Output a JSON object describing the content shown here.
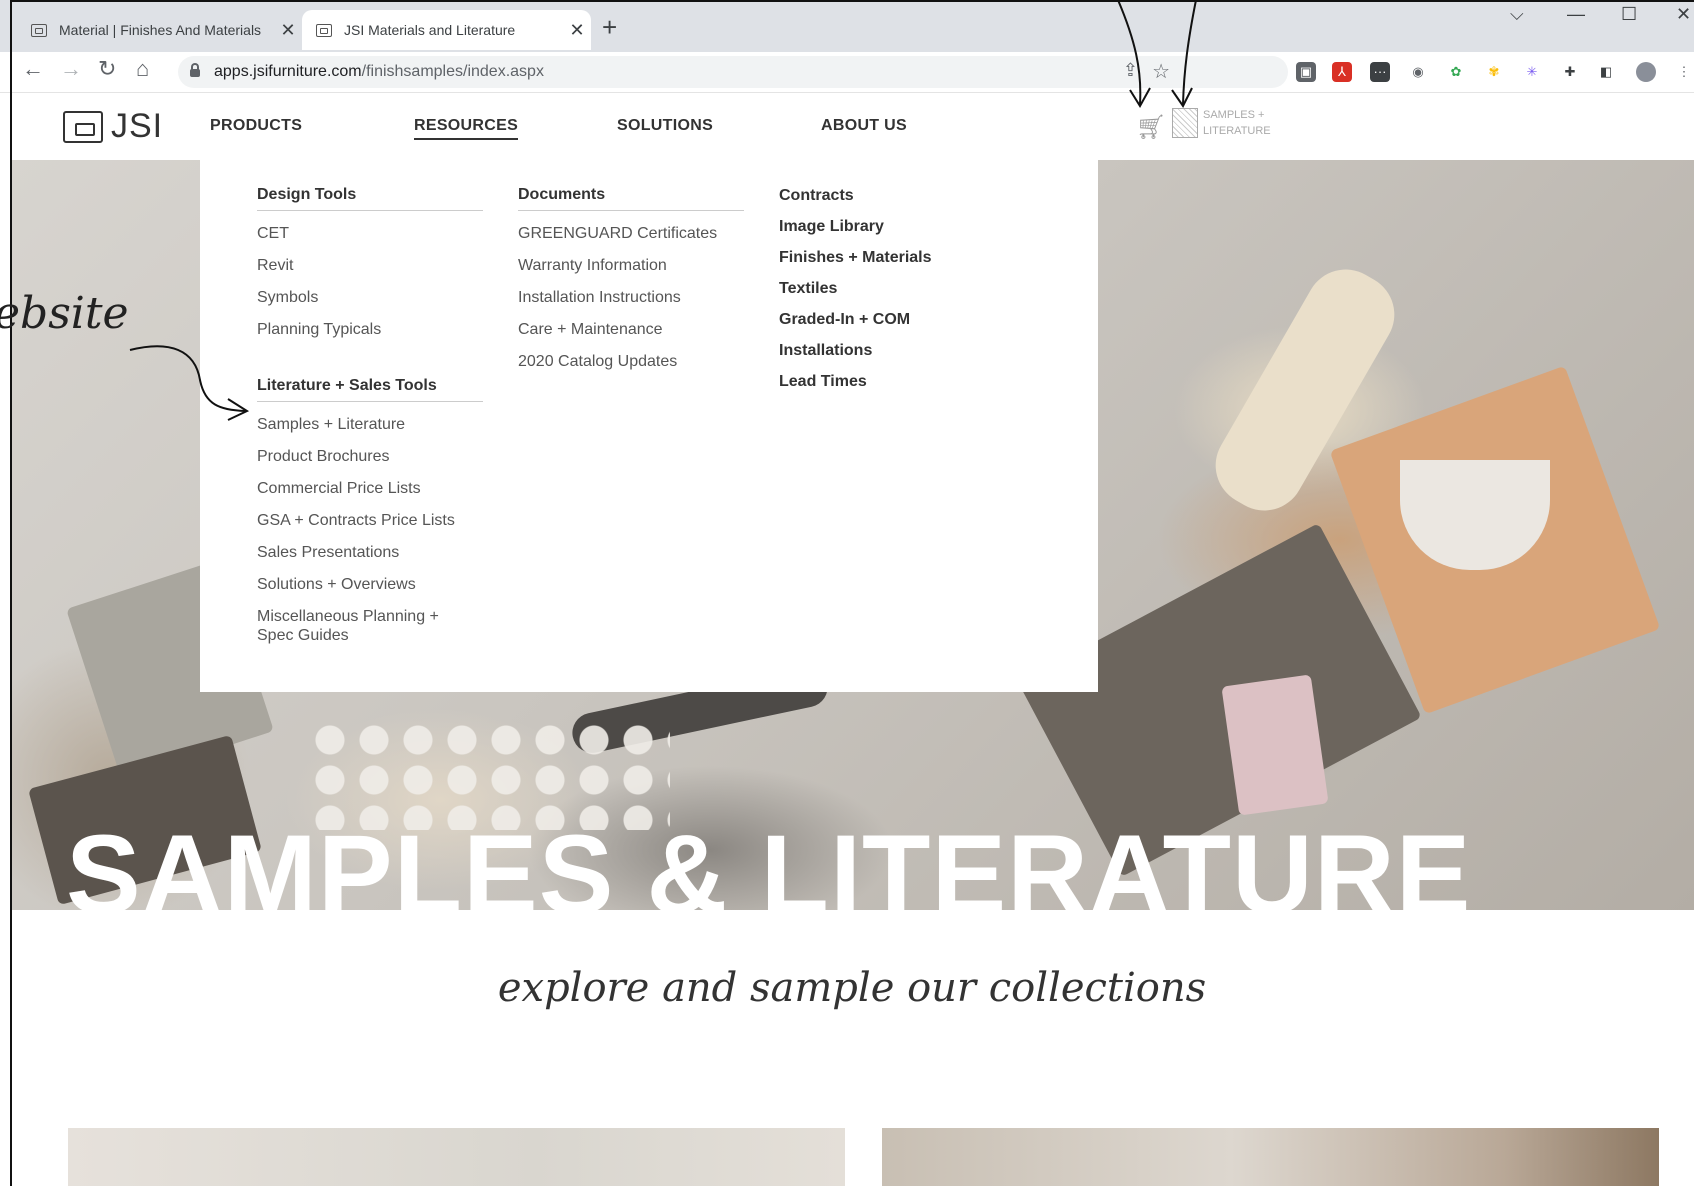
{
  "browser": {
    "tabs": [
      {
        "title": "Material | Finishes And Materials",
        "active": false
      },
      {
        "title": "JSI Materials and Literature",
        "active": true
      }
    ],
    "url_host": "apps.jsifurniture.com",
    "url_path": "/finishsamples/index.aspx",
    "icons": [
      "back-icon",
      "forward-icon",
      "reload-icon",
      "home-icon",
      "share-icon",
      "star-icon",
      "extension-icon",
      "profile-avatar"
    ]
  },
  "site": {
    "logo_text": "JSI",
    "nav": [
      "PRODUCTS",
      "RESOURCES",
      "SOLUTIONS",
      "ABOUT US"
    ],
    "active_nav": "RESOURCES",
    "samples_logo_line1": "SAMPLES +",
    "samples_logo_line2": "LITERATURE"
  },
  "dropdown": {
    "design_tools": {
      "heading": "Design Tools",
      "items": [
        "CET",
        "Revit",
        "Symbols",
        "Planning Typicals"
      ]
    },
    "literature": {
      "heading": "Literature + Sales Tools",
      "items": [
        "Samples + Literature",
        "Product Brochures",
        "Commercial Price Lists",
        "GSA + Contracts Price Lists",
        "Sales Presentations",
        "Solutions + Overviews",
        "Miscellaneous Planning +",
        "Spec Guides"
      ]
    },
    "documents": {
      "heading": "Documents",
      "items": [
        "GREENGUARD Certificates",
        "Warranty Information",
        "Installation Instructions",
        "Care + Maintenance",
        "2020 Catalog Updates"
      ]
    },
    "links": [
      "Contracts",
      "Image Library",
      "Finishes + Materials",
      "Textiles",
      "Graded-In + COM",
      "Installations",
      "Lead Times"
    ]
  },
  "hero": {
    "title": "SAMPLES & LITERATURE"
  },
  "tagline": "explore and sample our collections",
  "annotation": {
    "text": "ebsite"
  },
  "colors": {
    "chrome_bg": "#dee1e6",
    "text": "#333333",
    "hero_text": "#ffffff"
  }
}
